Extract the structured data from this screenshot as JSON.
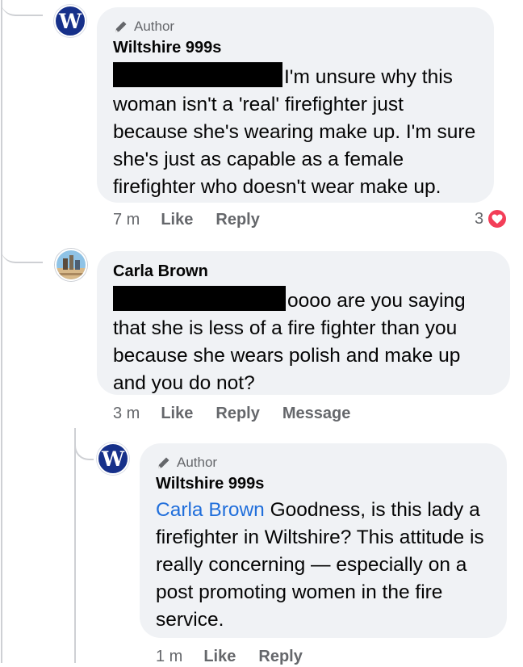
{
  "comments": [
    {
      "author_badge": "Author",
      "name": "Wiltshire 999s",
      "avatar_letter": "W",
      "text_after_redaction": "I'm unsure why this woman isn't a 'real' firefighter just because she's wearing make up. I'm sure she's just as capable as a female firefighter who doesn't wear make up.",
      "time": "7 m",
      "like_label": "Like",
      "reply_label": "Reply",
      "reaction_count": "3",
      "reaction_icon": "heart-icon"
    },
    {
      "name": "Carla Brown",
      "text_after_redaction": "oooo are you saying that she is less of a fire fighter than you because she wears polish and make up and you do not?",
      "time": "3 m",
      "like_label": "Like",
      "reply_label": "Reply",
      "message_label": "Message"
    },
    {
      "author_badge": "Author",
      "name": "Wiltshire 999s",
      "avatar_letter": "W",
      "mention": "Carla Brown",
      "text": "Goodness, is this lady a firefighter in Wiltshire? This attitude is really concerning — especially on a post promoting women in the fire service.",
      "time": "1 m",
      "like_label": "Like",
      "reply_label": "Reply"
    }
  ],
  "colors": {
    "bubble": "#f0f2f5",
    "secondary_text": "#65676b",
    "mention": "#216fdb",
    "heart": "#f33e58",
    "page_avatar": "#16308a"
  }
}
